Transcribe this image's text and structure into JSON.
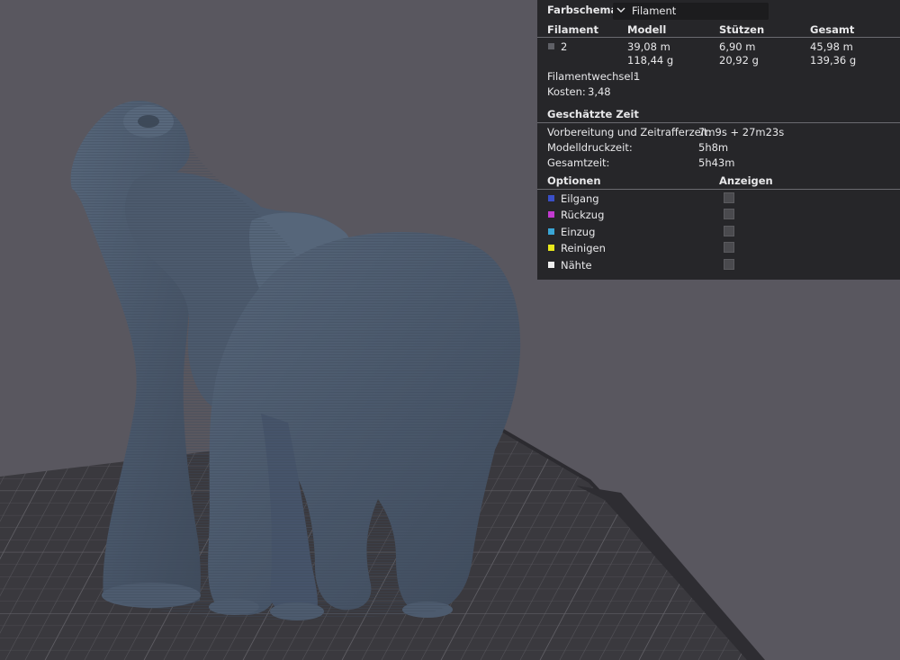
{
  "legend": {
    "color_scheme_label": "Farbschema",
    "color_scheme_value": "Filament",
    "columns": [
      "Filament",
      "Modell",
      "Stützen",
      "Gesamt"
    ],
    "filament_row": {
      "id": "2",
      "swatch_color": "#5f6066",
      "model_length": "39,08 m",
      "model_weight": "118,44 g",
      "support_length": "6,90 m",
      "support_weight": "20,92 g",
      "total_length": "45,98 m",
      "total_weight": "139,36 g"
    },
    "filament_changes_label": "Filamentwechsel:",
    "filament_changes_value": "1",
    "cost_label": "Kosten:",
    "cost_value": "3,48",
    "time_heading": "Geschätzte Zeit",
    "prep_label": "Vorbereitung und Zeitrafferzeit:",
    "prep_value": "7m9s + 27m23s",
    "model_time_label": "Modelldruckzeit:",
    "model_time_value": "5h8m",
    "total_time_label": "Gesamtzeit:",
    "total_time_value": "5h43m",
    "options_heading": "Optionen",
    "show_heading": "Anzeigen",
    "options": [
      {
        "label": "Eilgang",
        "color": "#3a4fc8"
      },
      {
        "label": "Rückzug",
        "color": "#c23ad0"
      },
      {
        "label": "Einzug",
        "color": "#3aa6d6"
      },
      {
        "label": "Reinigen",
        "color": "#e8e81c"
      },
      {
        "label": "Nähte",
        "color": "#f0f0f0"
      }
    ]
  }
}
